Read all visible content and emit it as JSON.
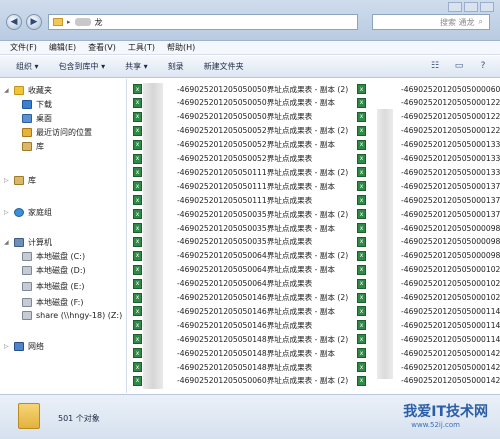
{
  "address": {
    "path_suffix": "龙"
  },
  "search": {
    "placeholder": "搜索 通龙"
  },
  "menu": [
    "文件(F)",
    "编辑(E)",
    "查看(V)",
    "工具(T)",
    "帮助(H)"
  ],
  "toolbar": {
    "organize": "组织 ▾",
    "include_library": "包含到库中 ▾",
    "share": "共享 ▾",
    "burn": "刻录",
    "new_folder": "新建文件夹"
  },
  "sidebar": {
    "favorites": "收藏夹",
    "downloads": "下载",
    "desktop": "桌面",
    "recent": "最近访问的位置",
    "libraries_fav": "库",
    "libraries": "库",
    "homegroup": "家庭组",
    "computer": "计算机",
    "drive_c": "本地磁盘 (C:)",
    "drive_d": "本地磁盘 (D:)",
    "drive_e": "本地磁盘 (E:)",
    "drive_f": "本地磁盘 (F:)",
    "share": "share (\\\\hngy-18) (Z:)",
    "network": "网络"
  },
  "files_left": [
    "-469025201205050050界址点成果表 - 副本 (2)",
    "-469025201205050050界址点成果表 - 副本",
    "-469025201205050050界址点成果表",
    "-469025201205050052界址点成果表 - 副本 (2)",
    "-469025201205050052界址点成果表 - 副本",
    "-469025201205050052界址点成果表",
    "-469025201205050111界址点成果表 - 副本 (2)",
    "-469025201205050111界址点成果表 - 副本",
    "-469025201205050111界址点成果表",
    "-469025201205050035界址点成果表 - 副本 (2)",
    "-469025201205050035界址点成果表 - 副本",
    "-469025201205050035界址点成果表",
    "-469025201205050064界址点成果表 - 副本 (2)",
    "-469025201205050064界址点成果表 - 副本",
    "-469025201205050064界址点成果表",
    "-469025201205050146界址点成果表 - 副本 (2)",
    "-469025201205050146界址点成果表 - 副本",
    "-469025201205050146界址点成果表",
    "-469025201205050148界址点成果表 - 副本 (2)",
    "-469025201205050148界址点成果表 - 副本",
    "-469025201205050148界址点成果表",
    "-469025201205050060界址点成果表 - 副本 (2)"
  ],
  "files_right": [
    "-46902520120505000060界址点",
    "-46902520120505000122界址点",
    "-46902520120505000122界址点",
    "-46902520120505000122界址点",
    "-46902520120505000133界址点",
    "-46902520120505000133界址点",
    "-46902520120505000133界址点",
    "-46902520120505000137界址点",
    "-46902520120505000137界址点",
    "-46902520120505000137界址点",
    "-46902520120505000098界址点",
    "-46902520120505000098界址点",
    "-46902520120505000098界址点",
    "-46902520120505000102界址点",
    "-46902520120505000102界址点",
    "-46902520120505000102界址点",
    "-46902520120505000114界址点",
    "-46902520120505000114界址点",
    "-46902520120505000114界址点",
    "-46902520120505000142界址点",
    "-46902520120505000142界址点",
    "-46902520120505000142界址点"
  ],
  "status": {
    "count": "501 个对象"
  },
  "watermark": {
    "text": "我爱IT技术网",
    "url": "www.52ij.com"
  }
}
